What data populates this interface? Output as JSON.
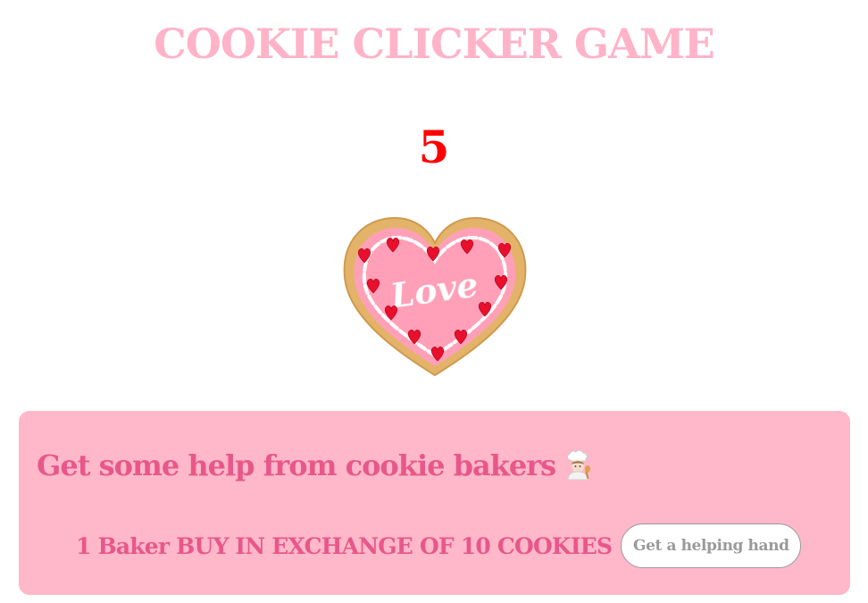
{
  "header": {
    "title": "COOKIE CLICKER GAME"
  },
  "game": {
    "cookie_count": "5",
    "cookie_text": "Love"
  },
  "shop": {
    "heading": "Get some help from cookie bakers",
    "heading_icon": "chef-icon",
    "offer_text": "1 Baker BUY IN EXCHANGE OF 10 COOKIES",
    "button_label": "Get a helping hand"
  },
  "colors": {
    "title": "#ffb3c8",
    "counter": "#ff0000",
    "panel_background": "#ffb8c9",
    "panel_text": "#e8578a",
    "button_text": "#9a9a9a"
  }
}
